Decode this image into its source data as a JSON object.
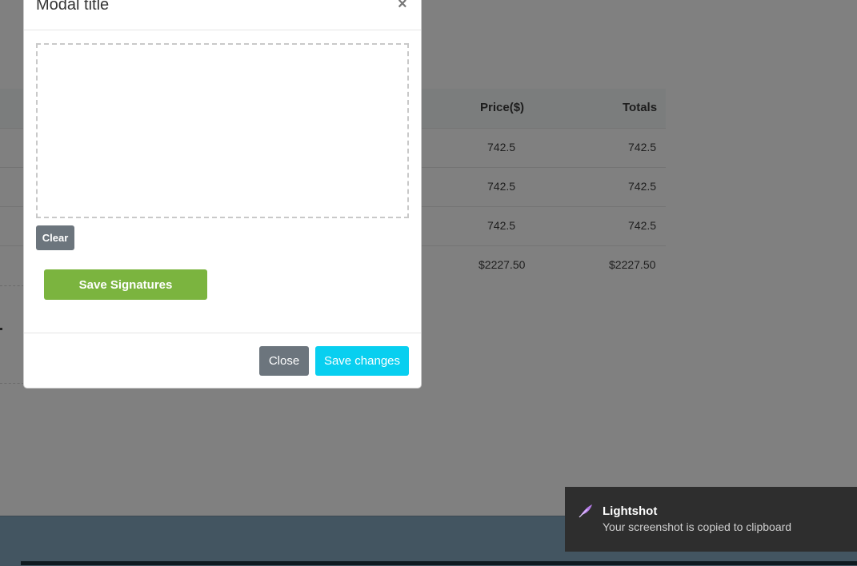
{
  "modal": {
    "title": "Modal title",
    "close_symbol": "×",
    "clear_label": "Clear",
    "save_signatures_label": "Save Signatures",
    "close_label": "Close",
    "save_changes_label": "Save changes"
  },
  "table": {
    "headers": [
      "Price($)",
      "Totals"
    ],
    "rows": [
      [
        "742.5",
        "742.5"
      ],
      [
        "742.5",
        "742.5"
      ],
      [
        "742.5",
        "742.5"
      ],
      [
        "$2227.50",
        "$2227.50"
      ]
    ]
  },
  "toast": {
    "app": "Lightshot",
    "message": "Your screenshot is copied to clipboard",
    "icon": "feather-icon"
  },
  "colors": {
    "save_signatures": "#7bb43f",
    "save_changes": "#08cff0",
    "secondary": "#6c757d",
    "toast_bg": "#2e2e2e",
    "footer_bg": "#435561"
  }
}
